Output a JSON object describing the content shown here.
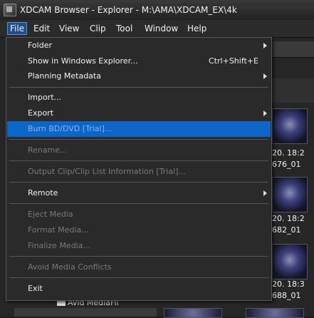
{
  "window": {
    "title": "XDCAM Browser - Explorer - M:\\AMA\\XDCAM_EX\\4k"
  },
  "menubar": [
    {
      "label": "File",
      "active": true
    },
    {
      "label": "Edit"
    },
    {
      "label": "View"
    },
    {
      "label": "Clip"
    },
    {
      "label": "Tool"
    },
    {
      "label": "Window"
    },
    {
      "label": "Help"
    }
  ],
  "file_menu": {
    "folder": "Folder",
    "show_in_explorer": "Show in Windows Explorer...",
    "show_in_explorer_shortcut": "Ctrl+Shift+E",
    "planning_metadata": "Planning Metadata",
    "import": "Import...",
    "export": "Export",
    "burn": "Burn BD/DVD [Trial]...",
    "rename": "Rename...",
    "output_clip_info": "Output Clip/Clip List Information [Trial]...",
    "remote": "Remote",
    "eject_media": "Eject Media",
    "format_media": "Format Media...",
    "finalize_media": "Finalize Media...",
    "avoid_conflicts": "Avoid Media Conflicts",
    "exit": "Exit"
  },
  "background": {
    "clips": [
      {
        "time": "20. 18:2",
        "name": "676_01"
      },
      {
        "time": "20. 18:2",
        "name": "682_01"
      },
      {
        "time": "20. 18:3",
        "name": "688_01"
      }
    ],
    "tree_item": "Avid MediaFil"
  },
  "colors": {
    "highlight": "#0c66c9",
    "menu_bg": "#2a2a2a",
    "disabled_text": "#7a7a7a"
  }
}
